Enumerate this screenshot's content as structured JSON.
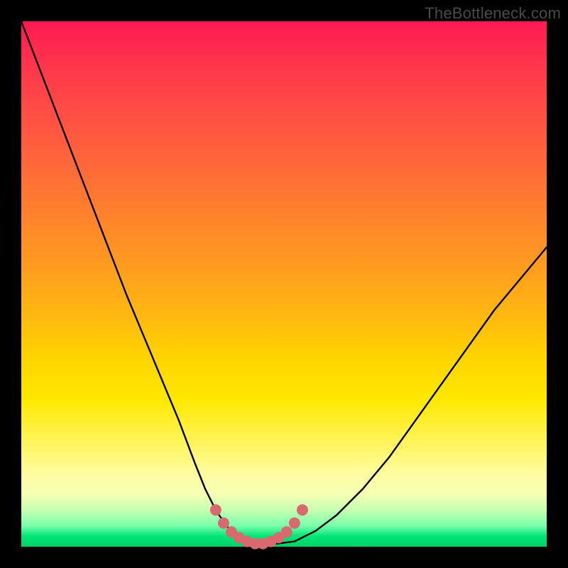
{
  "watermark": "TheBottleneck.com",
  "colors": {
    "frame": "#000000",
    "gradient_top": "#ff1a54",
    "gradient_mid": "#ffe800",
    "gradient_bottom": "#00d268",
    "curve": "#000000",
    "marker": "#d86a6f"
  },
  "chart_data": {
    "type": "line",
    "title": "",
    "xlabel": "",
    "ylabel": "",
    "xlim": [
      0,
      100
    ],
    "ylim": [
      0,
      100
    ],
    "series": [
      {
        "name": "bottleneck-curve",
        "x": [
          0,
          5,
          10,
          15,
          20,
          25,
          30,
          33,
          35,
          37,
          39,
          41,
          43,
          45,
          48,
          52,
          56,
          60,
          65,
          70,
          75,
          80,
          85,
          90,
          95,
          100
        ],
        "y": [
          100,
          87,
          74,
          61,
          48,
          36,
          24,
          16,
          11,
          7,
          4,
          2,
          1,
          0.5,
          0.5,
          1,
          3,
          6,
          11,
          17,
          24,
          31,
          38,
          45,
          51,
          57
        ]
      }
    ],
    "markers": {
      "name": "optimal-range-dots",
      "x": [
        37,
        38.5,
        40,
        41.5,
        43,
        44.5,
        46,
        47.5,
        49,
        50.5,
        52,
        53.5
      ],
      "y": [
        7,
        4.5,
        2.8,
        1.7,
        1,
        0.6,
        0.6,
        1,
        1.7,
        2.8,
        4.5,
        7
      ]
    }
  }
}
